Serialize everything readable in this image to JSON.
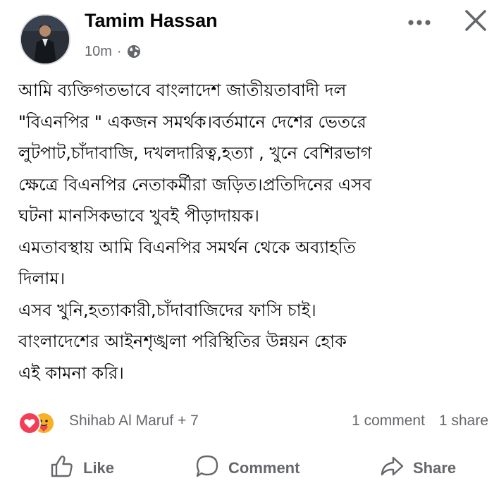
{
  "post": {
    "author": "Tamim Hassan",
    "time": "10m",
    "separator": "·",
    "audience_icon": "globe-icon",
    "menu_icon": "more-horizontal-icon",
    "close_icon": "close-icon",
    "text_lines": [
      "আমি ব্যক্তিগতভাবে বাংলাদেশ জাতীয়তাবাদী দল",
      "\"বিএনপির \" একজন সমর্থক।বর্তমানে দেশের ভেতরে",
      "লুটপাট,চাঁদাবাজি, দখলদারিত্ব,হত্যা , খুনে বেশিরভাগ",
      "ক্ষেত্রে বিএনপির নেতাকর্মীরা জড়িত।প্রতিদিনের এসব",
      "ঘটনা মানসিকভাবে খুবই পীড়াদায়ক।",
      "এমতাবস্থায় আমি বিএনপির সমর্থন থেকে অব্যাহতি",
      "দিলাম।",
      "এসব খুনি,হত্যাকারী,চাঁদাবাজিদের ফাসি চাই।",
      "বাংলাদেশের আইনশৃঙ্খলা পরিস্থিতির উন্নয়ন হোক",
      "এই কামনা করি।"
    ]
  },
  "reactions": {
    "icons": [
      "love-reaction-icon",
      "care-reaction-icon"
    ],
    "names": "Shihab Al Maruf + 7",
    "comments": "1 comment",
    "shares": "1 share",
    "colors": {
      "love": "#f33e58",
      "care": "#f7b125"
    }
  },
  "actions": {
    "like": "Like",
    "comment": "Comment",
    "share": "Share"
  }
}
